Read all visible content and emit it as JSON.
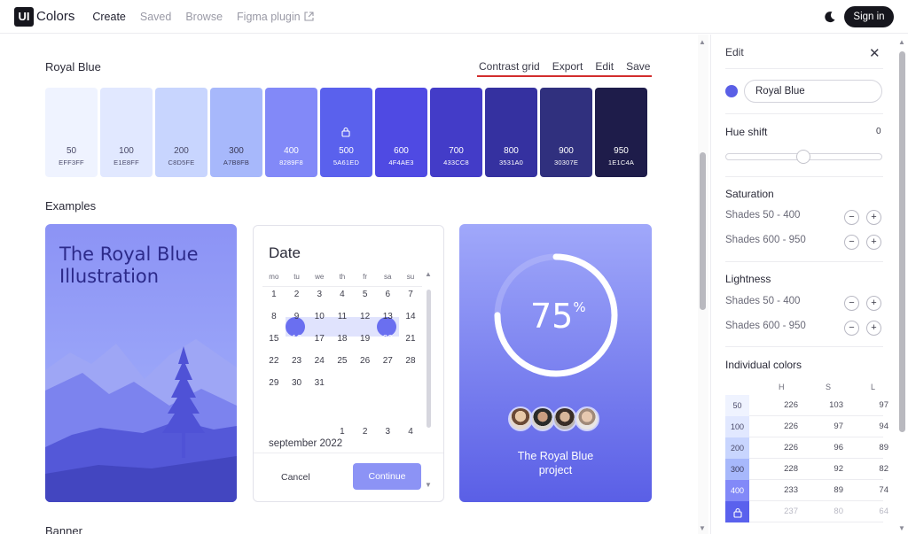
{
  "nav": {
    "logo_mark": "UI",
    "logo_text": "Colors",
    "links": [
      "Create",
      "Saved",
      "Browse",
      "Figma plugin"
    ],
    "signin": "Sign in"
  },
  "palette": {
    "title": "Royal Blue",
    "actions": [
      "Contrast grid",
      "Export",
      "Edit",
      "Save"
    ],
    "swatches": [
      {
        "name": "50",
        "hex": "EFF3FF",
        "color": "#eff3ff",
        "text": "#4a4a6a"
      },
      {
        "name": "100",
        "hex": "E1E8FF",
        "color": "#e1e8ff",
        "text": "#4a4a6a"
      },
      {
        "name": "200",
        "hex": "C8D5FE",
        "color": "#c8d5fe",
        "text": "#4a4a6a"
      },
      {
        "name": "300",
        "hex": "A7B8FB",
        "color": "#a7b8fb",
        "text": "#3a3a5a"
      },
      {
        "name": "400",
        "hex": "8289F8",
        "color": "#8289f8",
        "text": "#ffffff"
      },
      {
        "name": "500",
        "hex": "5A61ED",
        "color": "#5a61ed",
        "text": "#ffffff"
      },
      {
        "name": "600",
        "hex": "4F4AE3",
        "color": "#4f4ae3",
        "text": "#ffffff"
      },
      {
        "name": "700",
        "hex": "433CC8",
        "color": "#433cc8",
        "text": "#ffffff"
      },
      {
        "name": "800",
        "hex": "3531A0",
        "color": "#3531a0",
        "text": "#ffffff"
      },
      {
        "name": "900",
        "hex": "30307E",
        "color": "#30307e",
        "text": "#ffffff"
      },
      {
        "name": "950",
        "hex": "1E1C4A",
        "color": "#1e1c4a",
        "text": "#ffffff"
      }
    ]
  },
  "examples": {
    "title": "Examples",
    "illustration_title": [
      "The Royal Blue",
      "Illustration"
    ],
    "date_card": {
      "title": "Date",
      "days_of_week": [
        "mo",
        "tu",
        "we",
        "th",
        "fr",
        "sa",
        "su"
      ],
      "weeks": [
        [
          "1",
          "2",
          "3",
          "4",
          "5",
          "6",
          "7"
        ],
        [
          "8",
          "9",
          "10",
          "11",
          "12",
          "13",
          "14"
        ],
        [
          "15",
          "16",
          "17",
          "18",
          "19",
          "20",
          "21"
        ],
        [
          "22",
          "23",
          "24",
          "25",
          "26",
          "27",
          "28"
        ],
        [
          "29",
          "30",
          "31",
          "",
          "",
          "",
          ""
        ]
      ],
      "month": "september 2022",
      "next_month_week": [
        "",
        "",
        "",
        "1",
        "2",
        "3",
        "4"
      ],
      "cancel": "Cancel",
      "continue": "Continue"
    },
    "project_card": {
      "percent": "75",
      "percent_sign": "%",
      "progress": 0.75,
      "title": [
        "The Royal Blue",
        "project"
      ]
    },
    "banner_title": "Banner"
  },
  "edit_panel": {
    "title": "Edit",
    "color_name": "Royal Blue",
    "hue_shift_label": "Hue shift",
    "hue_shift_value": "0",
    "saturation_label": "Saturation",
    "lightness_label": "Lightness",
    "shades_low": "Shades 50 - 400",
    "shades_high": "Shades 600 - 950",
    "minus": "−",
    "plus": "+",
    "individual_label": "Individual colors",
    "columns": [
      "H",
      "S",
      "L"
    ],
    "rows": [
      {
        "shade": "50",
        "h": "226",
        "s": "103",
        "l": "97",
        "color": "#eff3ff",
        "text": "#4a4a6a"
      },
      {
        "shade": "100",
        "h": "226",
        "s": "97",
        "l": "94",
        "color": "#e1e8ff",
        "text": "#4a4a6a"
      },
      {
        "shade": "200",
        "h": "226",
        "s": "96",
        "l": "89",
        "color": "#c8d5fe",
        "text": "#4a4a6a"
      },
      {
        "shade": "300",
        "h": "228",
        "s": "92",
        "l": "82",
        "color": "#a7b8fb",
        "text": "#3a3a5a"
      },
      {
        "shade": "400",
        "h": "233",
        "s": "89",
        "l": "74",
        "color": "#8289f8",
        "text": "#ffffff"
      },
      {
        "shade": "",
        "h": "237",
        "s": "80",
        "l": "64",
        "color": "#5a61ed",
        "text": "#ffffff"
      }
    ]
  }
}
